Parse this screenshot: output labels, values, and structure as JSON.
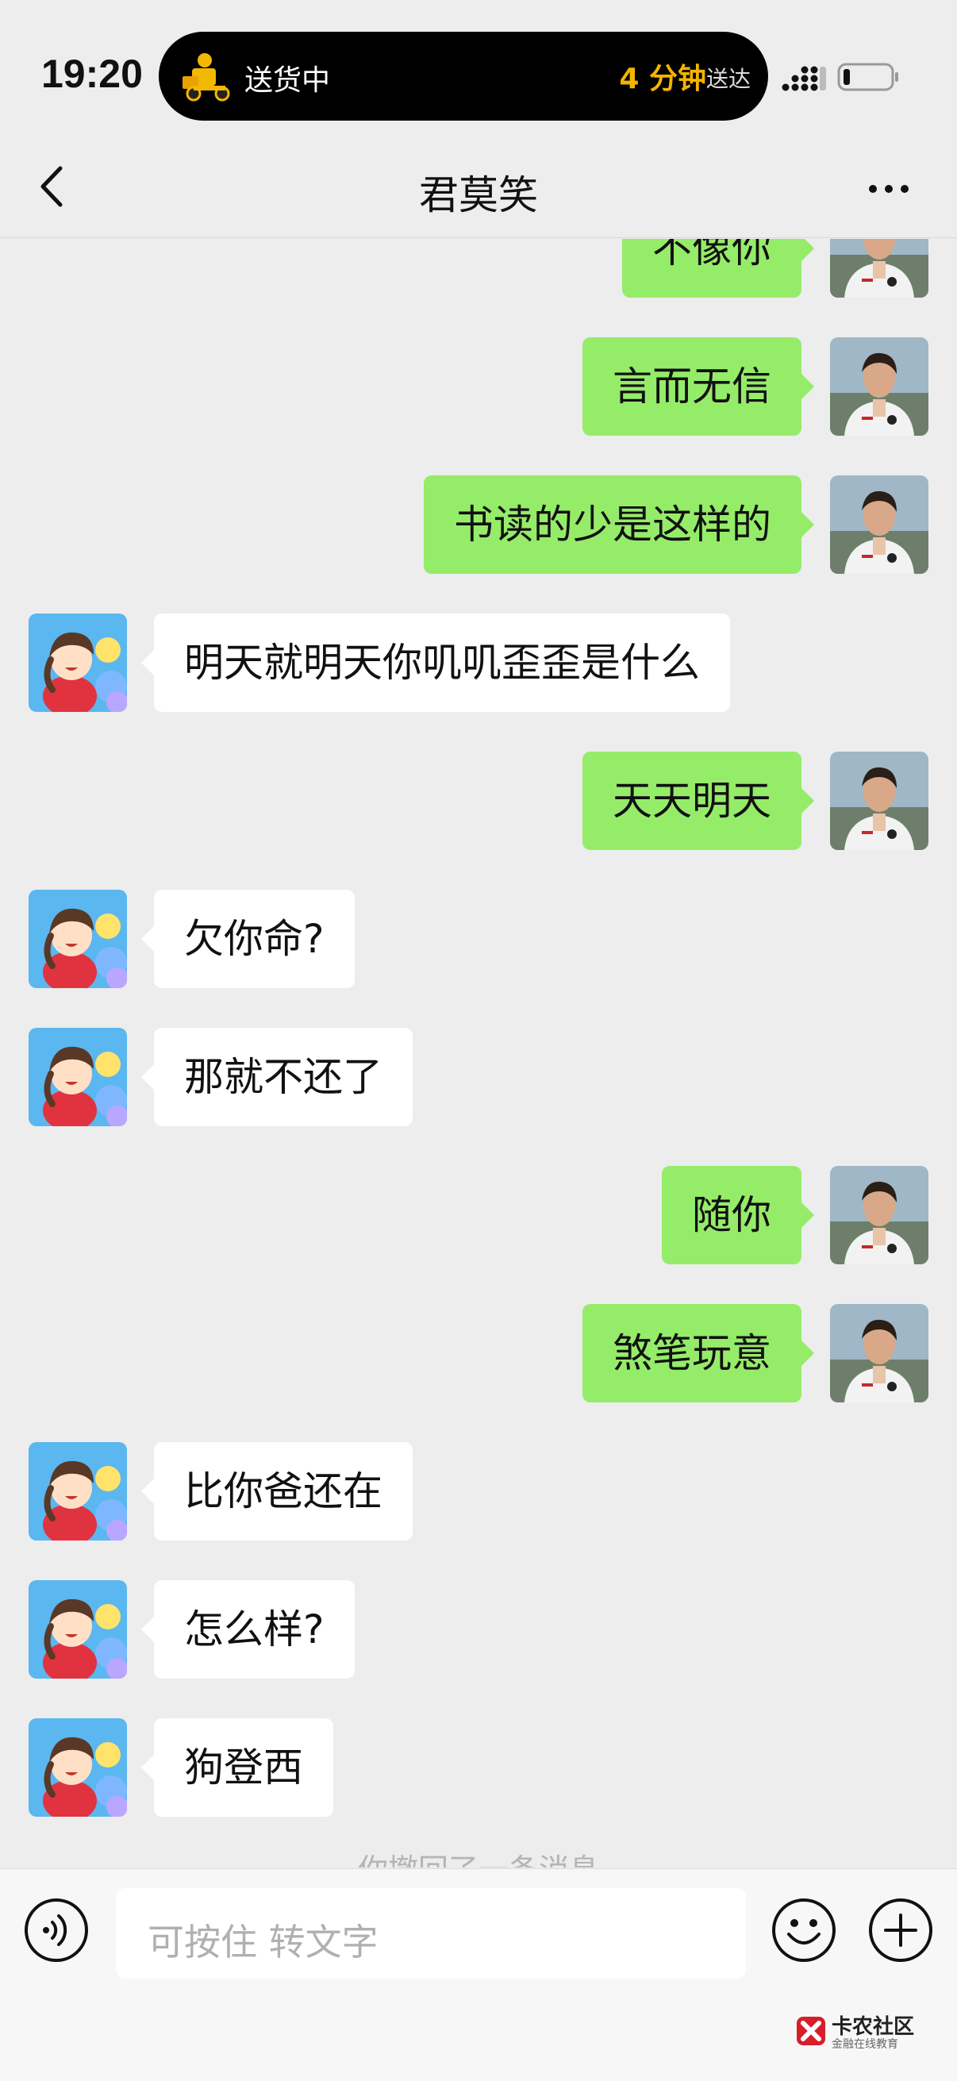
{
  "status_bar": {
    "time": "19:20",
    "live_activity": {
      "status": "送货中",
      "eta": "4 分钟",
      "eta_label": "送达"
    }
  },
  "nav": {
    "title": "君莫笑"
  },
  "messages": [
    {
      "side": "right",
      "text": "不像你"
    },
    {
      "side": "right",
      "text": "言而无信"
    },
    {
      "side": "right",
      "text": "书读的少是这样的"
    },
    {
      "side": "left",
      "text": "明天就明天你叽叽歪歪是什么"
    },
    {
      "side": "right",
      "text": "天天明天"
    },
    {
      "side": "left",
      "text": "欠你命?"
    },
    {
      "side": "left",
      "text": "那就不还了"
    },
    {
      "side": "right",
      "text": "随你"
    },
    {
      "side": "right",
      "text": "煞笔玩意"
    },
    {
      "side": "left",
      "text": "比你爸还在"
    },
    {
      "side": "left",
      "text": "怎么样?"
    },
    {
      "side": "left",
      "text": "狗登西"
    }
  ],
  "recall_note": "你撤回了一条消息",
  "input": {
    "placeholder": "可按住 转文字"
  },
  "watermark": {
    "title": "卡农社区",
    "subtitle": "金融在线教育"
  },
  "colors": {
    "background": "#ededed",
    "self_bubble": "#95ec69",
    "other_bubble": "#ffffff",
    "eta": "#f5b400"
  },
  "icons": [
    "delivery-rider-icon",
    "signal-icon",
    "battery-icon",
    "back-icon",
    "more-icon",
    "voice-icon",
    "emoji-icon",
    "plus-icon"
  ]
}
